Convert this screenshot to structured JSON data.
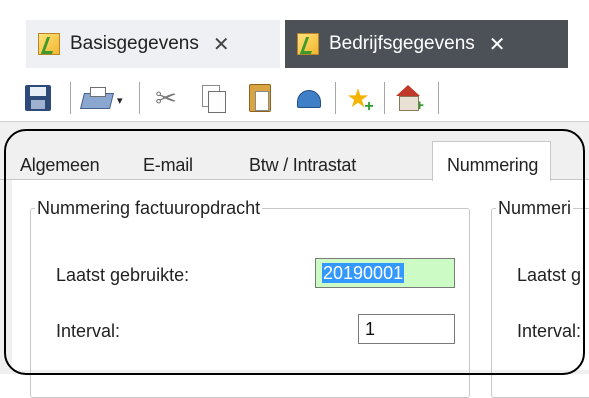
{
  "doc_tabs": [
    {
      "label": "Basisgegevens",
      "close": "✕",
      "active": false
    },
    {
      "label": "Bedrijfsgegevens",
      "close": "✕",
      "active": true
    }
  ],
  "toolbar": {
    "buttons": [
      "save-icon",
      "print-icon",
      "cut-icon",
      "copy-icon",
      "paste-icon",
      "undo-icon",
      "add-favorite-icon",
      "add-home-icon"
    ],
    "dropdown_glyph": "▾"
  },
  "inner_tabs": [
    {
      "label": "Algemeen",
      "active": false
    },
    {
      "label": "E-mail",
      "active": false
    },
    {
      "label": "Btw / Intrastat",
      "active": false
    },
    {
      "label": "Nummering",
      "active": true
    }
  ],
  "groups": [
    {
      "title": "Nummering factuuropdracht",
      "fields": [
        {
          "label": "Laatst gebruikte:",
          "value": "20190001"
        },
        {
          "label": "Interval:",
          "value": "1"
        }
      ]
    },
    {
      "title": "Nummeri",
      "fields": [
        {
          "label": "Laatst g",
          "value": ""
        },
        {
          "label": "Interval:",
          "value": ""
        }
      ]
    }
  ],
  "colors": {
    "active_doc_tab": "#4c5158",
    "highlight_field": "#cdfbc6",
    "selection": "#3399ff"
  }
}
